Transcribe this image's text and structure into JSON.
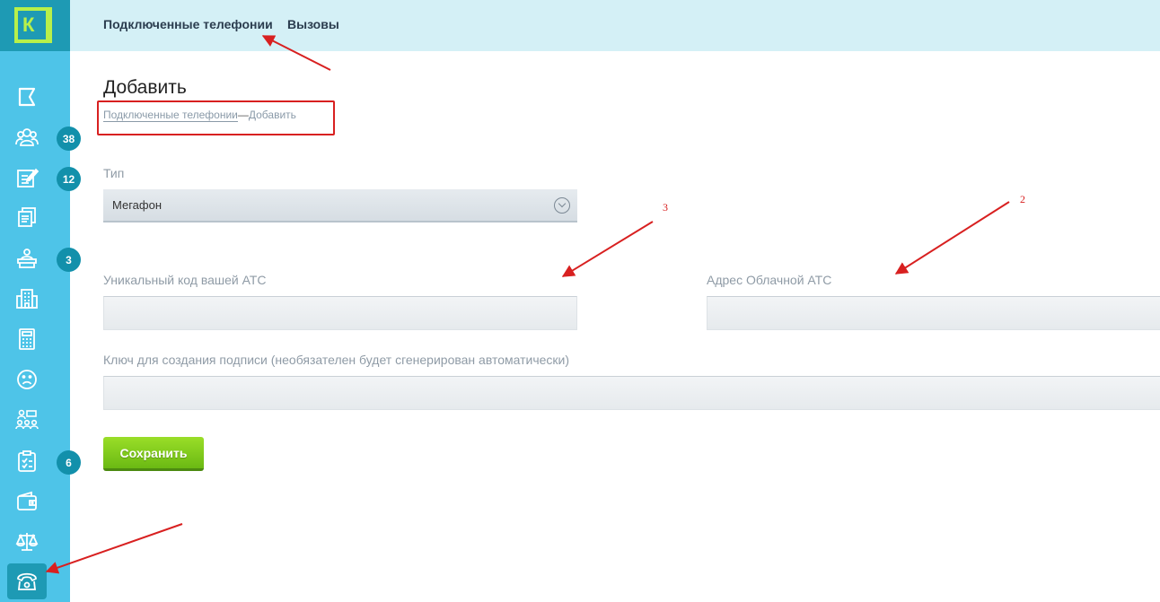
{
  "app": {
    "logo_letter": "К"
  },
  "sidebar": {
    "items": [
      {
        "icon": "flag-icon"
      },
      {
        "icon": "users-icon",
        "badge": "38"
      },
      {
        "icon": "edit-note-icon",
        "badge": "12"
      },
      {
        "icon": "documents-icon"
      },
      {
        "icon": "reception-desk-icon",
        "badge": "3"
      },
      {
        "icon": "building-icon"
      },
      {
        "icon": "calculator-icon"
      },
      {
        "icon": "sad-face-icon"
      },
      {
        "icon": "team-icon"
      },
      {
        "icon": "checklist-icon",
        "badge": "6"
      },
      {
        "icon": "wallet-icon"
      },
      {
        "icon": "scales-icon"
      },
      {
        "icon": "phone-icon",
        "active": true
      }
    ]
  },
  "topnav": {
    "tabs": [
      {
        "label": "Подключенные телефонии"
      },
      {
        "label": "Вызовы"
      }
    ]
  },
  "page": {
    "title": "Добавить",
    "breadcrumb": {
      "link": "Подключенные телефонии",
      "separator": "—",
      "current": "Добавить"
    }
  },
  "form": {
    "type_label": "Тип",
    "type_value": "Мегафон",
    "code_label": "Уникальный код вашей АТС",
    "code_value": "",
    "address_label": "Адрес Облачной АТС",
    "address_value": "",
    "key_label": "Ключ для создания подписи (необязателен будет сгенерирован автоматически)",
    "key_value": "",
    "save_label": "Сохранить"
  },
  "annotations": {
    "num_3": "3",
    "num_2": "2",
    "color": "#d82020"
  },
  "colors": {
    "sidebar": "#4ec4e8",
    "sidebar_dark": "#1e9ab4",
    "topbar": "#d4f0f6",
    "accent_green": "#7cc81a",
    "logo_green": "#b8f04a"
  }
}
